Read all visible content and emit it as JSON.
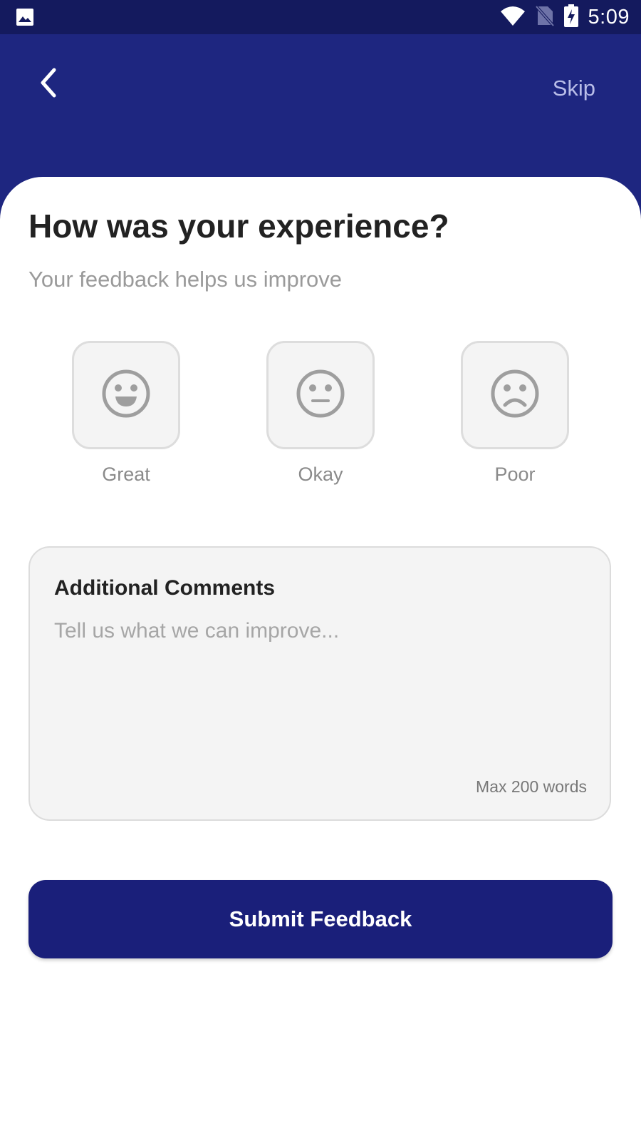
{
  "status_bar": {
    "time": "5:09",
    "icons": [
      "image-icon",
      "wifi-icon",
      "no-sim-icon",
      "battery-charging-icon"
    ]
  },
  "header": {
    "back_icon": "chevron-left-icon",
    "skip_label": "Skip"
  },
  "main": {
    "title": "How was your experience?",
    "subtitle": "Your feedback helps us improve",
    "ratings": [
      {
        "label": "Great",
        "icon": "happy-face-icon"
      },
      {
        "label": "Okay",
        "icon": "neutral-face-icon"
      },
      {
        "label": "Poor",
        "icon": "sad-face-icon"
      }
    ]
  },
  "comments": {
    "title": "Additional Comments",
    "placeholder": "Tell us what we can improve...",
    "value": "",
    "max_words_label": "Max 200 words"
  },
  "submit": {
    "label": "Submit Feedback"
  },
  "colors": {
    "status_bar": "#141a5e",
    "header": "#1e2680",
    "primary_button": "#1a1f7a",
    "card_background": "#f4f4f4"
  }
}
